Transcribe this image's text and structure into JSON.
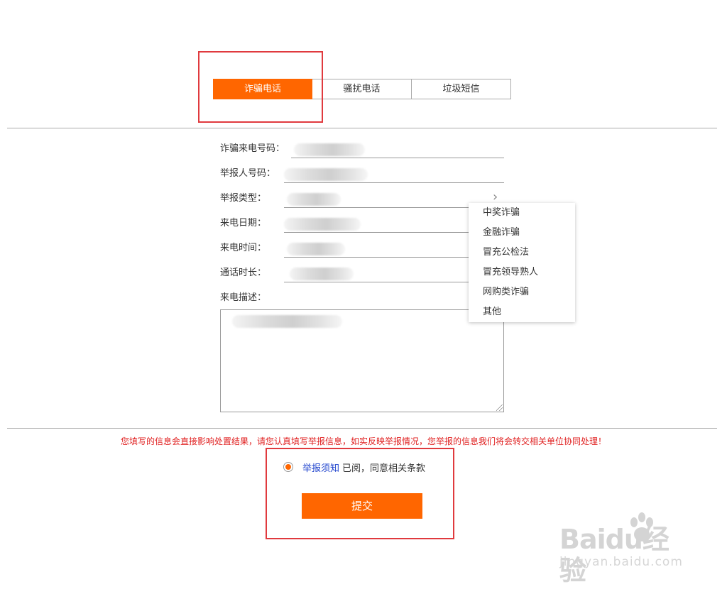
{
  "tabs": [
    {
      "label": "诈骗电话",
      "active": true
    },
    {
      "label": "骚扰电话",
      "active": false
    },
    {
      "label": "垃圾短信",
      "active": false
    }
  ],
  "form": {
    "fraud_number_label": "诈骗来电号码：",
    "reporter_number_label": "举报人号码：",
    "report_type_label": "举报类型：",
    "call_date_label": "来电日期：",
    "call_time_label": "来电时间：",
    "call_duration_label": "通话时长：",
    "description_label": "来电描述："
  },
  "dropdown": {
    "options": [
      "中奖诈骗",
      "金融诈骗",
      "冒充公检法",
      "冒充领导熟人",
      "网购类诈骗",
      "其他"
    ]
  },
  "notice": {
    "warning": "您填写的信息会直接影响处置结果，请您认真填写举报信息，如实反映举报情况，您举报的信息我们将会转交相关单位协同处理！",
    "agree_link": "举报须知",
    "agree_text": "已阅，同意相关条款"
  },
  "submit_label": "提交",
  "watermark": {
    "main": "Baidu经验",
    "sub": "jingyan.baidu.com"
  },
  "colors": {
    "accent": "#ff6600",
    "warning": "#e02020",
    "link": "#1a3fcc",
    "annotation": "#e03a3e"
  }
}
